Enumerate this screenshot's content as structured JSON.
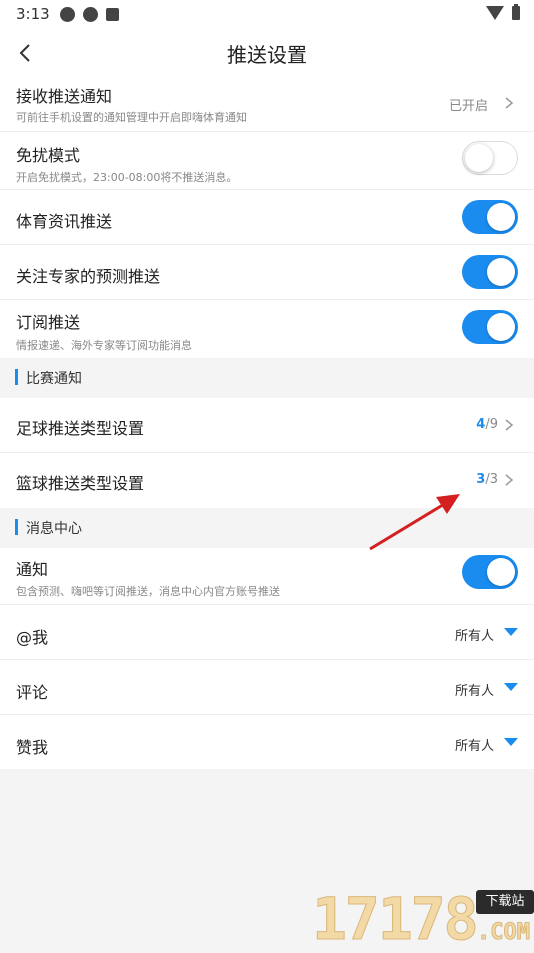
{
  "status_bar": {
    "time": "3:13"
  },
  "header": {
    "title": "推送设置"
  },
  "settings": {
    "receive_push": {
      "title": "接收推送通知",
      "subtitle": "可前往手机设置的通知管理中开启即嗨体育通知",
      "value": "已开启"
    },
    "dnd": {
      "title": "免扰模式",
      "subtitle": "开启免扰模式，23:00-08:00将不推送消息。",
      "enabled": false
    },
    "sports_news": {
      "title": "体育资讯推送",
      "enabled": true
    },
    "expert_predictions": {
      "title": "关注专家的预测推送",
      "enabled": true
    },
    "subscription": {
      "title": "订阅推送",
      "subtitle": "情报速递、海外专家等订阅功能消息",
      "enabled": true
    }
  },
  "match_section": {
    "label": "比赛通知",
    "football": {
      "title": "足球推送类型设置",
      "selected": "4",
      "total": "/9"
    },
    "basketball": {
      "title": "篮球推送类型设置",
      "selected": "3",
      "total": "/3"
    }
  },
  "message_section": {
    "label": "消息中心",
    "notification": {
      "title": "通知",
      "subtitle": "包含预测、嗨吧等订阅推送，消息中心内官方账号推送",
      "enabled": true
    },
    "mention": {
      "title": "@我",
      "value": "所有人"
    },
    "comment": {
      "title": "评论",
      "value": "所有人"
    },
    "like": {
      "title": "赞我",
      "value": "所有人"
    }
  },
  "watermark": {
    "number": "17178",
    "badge": "下载站",
    "domain": ".COM"
  },
  "colors": {
    "accent": "#1a8cf0",
    "annotation_arrow": "#d42020"
  }
}
